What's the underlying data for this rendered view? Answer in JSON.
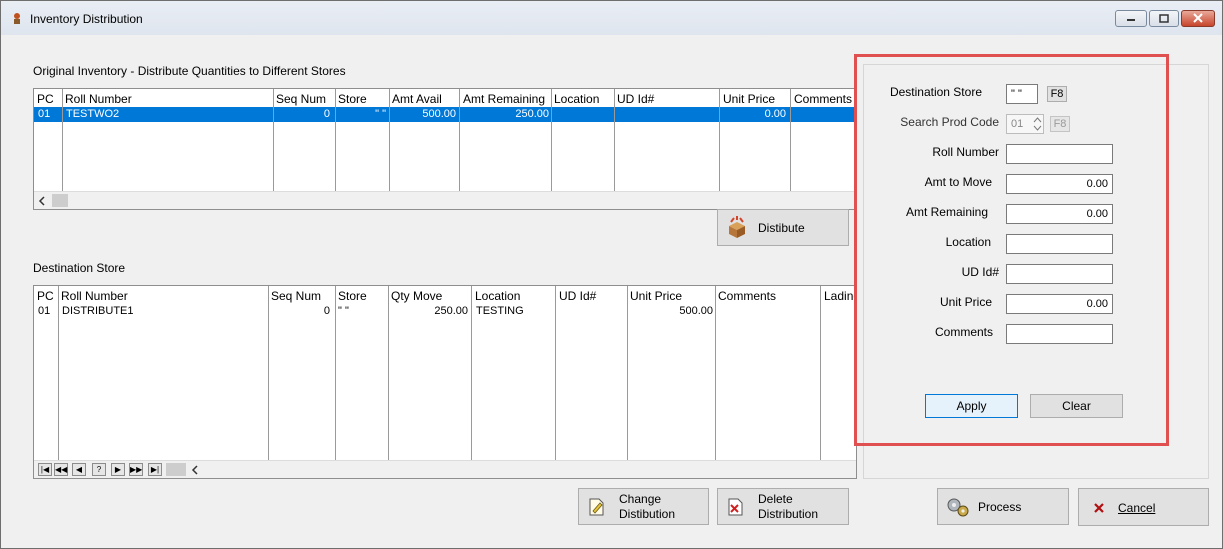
{
  "window": {
    "title": "Inventory Distribution"
  },
  "original": {
    "section_label": "Original Inventory - Distribute Quantities to Different Stores",
    "headers": [
      "PC",
      "Roll Number",
      "Seq Num",
      "Store",
      "Amt Avail",
      "Amt Remaining",
      "Location",
      "UD Id#",
      "Unit Price",
      "Comments"
    ],
    "row": [
      "01",
      "TESTWO2",
      "0",
      "\" \"",
      "500.00",
      "250.00",
      "",
      "",
      "0.00",
      ""
    ],
    "distribute_label": "Distibute"
  },
  "destination": {
    "section_label": "Destination Store",
    "headers": [
      "PC",
      "Roll Number",
      "Seq Num",
      "Store",
      "Qty Move",
      "Location",
      "UD Id#",
      "Unit Price",
      "Comments",
      "Lading"
    ],
    "row": [
      "01",
      "DISTRIBUTE1",
      "0",
      "\" \"",
      "250.00",
      "TESTING",
      "",
      "500.00",
      "",
      ""
    ],
    "nav_buttons": [
      "|◀",
      "◀◀",
      "◀",
      "?",
      "▶",
      "▶▶",
      "▶|"
    ],
    "change_label_1": "Change",
    "change_label_2": "Distibution",
    "delete_label_1": "Delete",
    "delete_label_2": "Distribution"
  },
  "form": {
    "destination_store_label": "Destination Store",
    "destination_store_value": "\" \"",
    "f8": "F8",
    "search_prod_code_label": "Search Prod Code",
    "search_prod_code_value": "01",
    "roll_number_label": "Roll Number",
    "roll_number_value": "",
    "amt_to_move_label": "Amt to Move",
    "amt_to_move_value": "0.00",
    "amt_remaining_label": "Amt Remaining",
    "amt_remaining_value": "0.00",
    "location_label": "Location",
    "location_value": "",
    "ud_id_label": "UD Id#",
    "ud_id_value": "",
    "unit_price_label": "Unit Price",
    "unit_price_value": "0.00",
    "comments_label": "Comments",
    "comments_value": "",
    "apply_label": "Apply",
    "clear_label": "Clear"
  },
  "footer": {
    "process_label": "Process",
    "cancel_label": "Cancel"
  },
  "colors": {
    "highlight_border": "#e05050",
    "selection": "#0078d7"
  }
}
